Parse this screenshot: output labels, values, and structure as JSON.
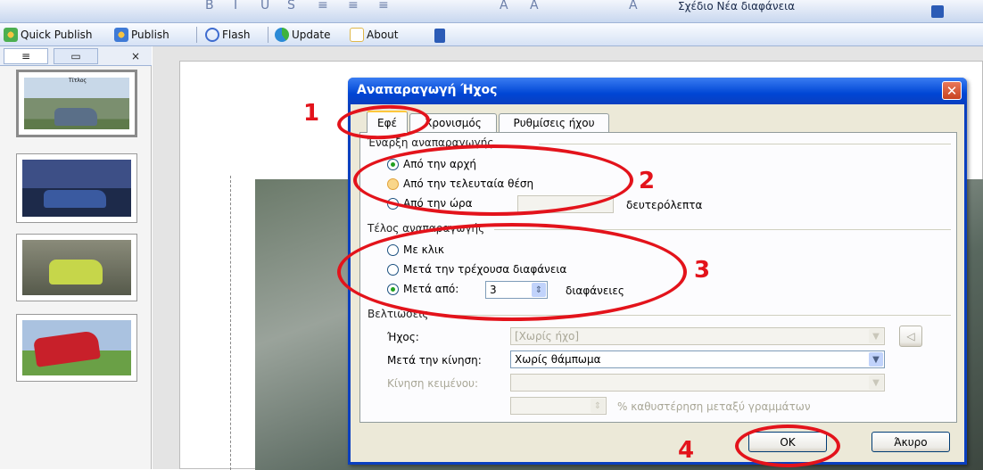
{
  "topbar": {
    "visible_text_right": "Σχέδιο    Νέα διαφάνεια"
  },
  "pubbar": {
    "items": [
      {
        "label": "Quick Publish",
        "icon": "quick-publish-icon"
      },
      {
        "label": "Publish",
        "icon": "publish-icon"
      },
      {
        "label": "Flash",
        "icon": "flash-icon"
      },
      {
        "label": "Update",
        "icon": "update-icon"
      },
      {
        "label": "About",
        "icon": "about-icon"
      }
    ]
  },
  "leftpanel": {
    "tabs": [
      "≡",
      "▭",
      "×"
    ],
    "thumb1_caption": "Τίτλος"
  },
  "dialog": {
    "title": "Αναπαραγωγή Ήχος",
    "tabs": [
      "Εφέ",
      "Χρονισμός",
      "Ρυθμίσεις ήχου"
    ],
    "start_group": {
      "label": "Έναρξη αναπαραγωγής",
      "options": [
        "Από την αρχή",
        "Από την τελευταία θέση",
        "Από την ώρα"
      ],
      "seconds_label": "δευτερόλεπτα",
      "selected": 0
    },
    "stop_group": {
      "label": "Τέλος αναπαραγωγής",
      "options": [
        "Με κλικ",
        "Μετά την τρέχουσα διαφάνεια",
        "Μετά από:"
      ],
      "slides_label": "διαφάνειες",
      "slides_value": "3",
      "selected": 2
    },
    "enhance_group": {
      "label": "Βελτιώσεις",
      "sound_label": "Ήχος:",
      "sound_value": "[Χωρίς ήχο]",
      "after_anim_label": "Μετά την κίνηση:",
      "after_anim_value": "Χωρίς θάμπωμα",
      "text_anim_label": "Κίνηση κειμένου:",
      "delay_label": "% καθυστέρηση μεταξύ γραμμάτων"
    },
    "ok_label": "OK",
    "cancel_label": "Άκυρο"
  },
  "annotations": [
    "1",
    "2",
    "3",
    "4"
  ],
  "colors": {
    "title_blue": "#0046d5",
    "annotation_red": "#e3131b",
    "dialog_bg": "#ece9d8"
  }
}
